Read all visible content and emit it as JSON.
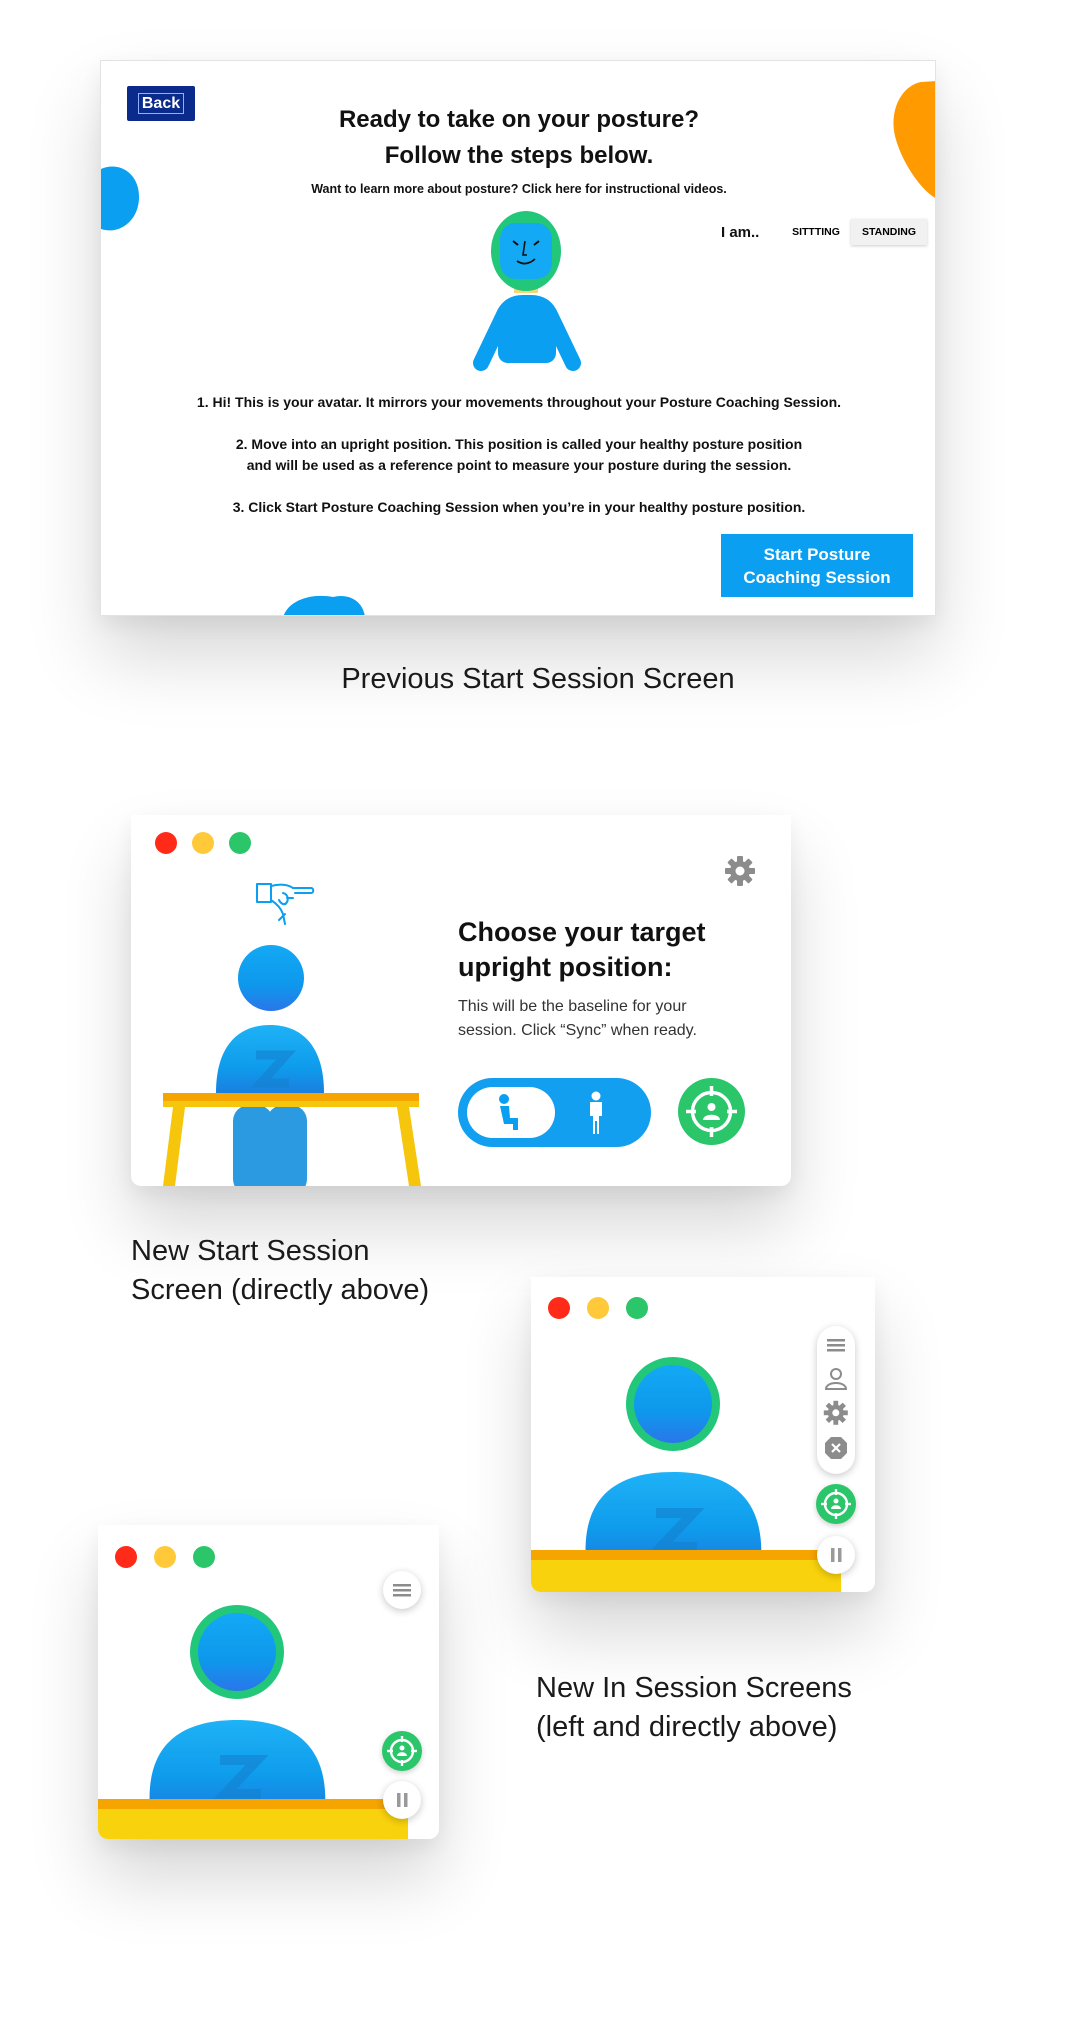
{
  "colors": {
    "brand_blue": "#0a9ff0",
    "back_button": "#0a2a8c",
    "sync_green": "#2bc56a",
    "desk_yellow": "#f5c60c",
    "orange_blob": "#ff9a00",
    "close_red": "#ff2a17",
    "minimize_yellow": "#ffc93a",
    "maximize_green": "#2bc56a"
  },
  "previous_screen": {
    "back_label": "Back",
    "title_line1": "Ready to take on your posture?",
    "title_line2": "Follow the steps below.",
    "learn_more": "Want to learn more about posture? Click here for instructional videos.",
    "i_am_label": "I am..",
    "options": [
      "SITTTING",
      "STANDING"
    ],
    "selected_option": "STANDING",
    "step1": "1. Hi! This is your avatar. It mirrors your movements throughout your Posture Coaching Session.",
    "step2_line1": "2. Move into an upright position. This position is called your healthy posture position",
    "step2_line2": "and will be used as a reference point to measure your posture during the session.",
    "step3": "3. Click Start Posture Coaching Session when you’re in your healthy posture position.",
    "start_label_line1": "Start Posture",
    "start_label_line2": "Coaching Session",
    "caption": "Previous Start Session Screen"
  },
  "new_start_screen": {
    "heading_line1": "Choose your target",
    "heading_line2": "upright position:",
    "subtext_line1": "This will be the baseline for your",
    "subtext_line2": "session. Click “Sync” when ready.",
    "selected_mode": "sitting",
    "icons": [
      "gear-icon",
      "sitting-person-icon",
      "standing-person-icon",
      "sync-target-icon",
      "pointing-hand-icon"
    ],
    "caption_line1": "New Start Session",
    "caption_line2": "Screen (directly above)"
  },
  "in_session_screens": {
    "icons": [
      "menu-icon",
      "profile-icon",
      "gear-icon",
      "close-icon",
      "sync-target-icon",
      "pause-icon"
    ],
    "caption_line1": "New In Session Screens",
    "caption_line2": "(left and directly above)"
  }
}
